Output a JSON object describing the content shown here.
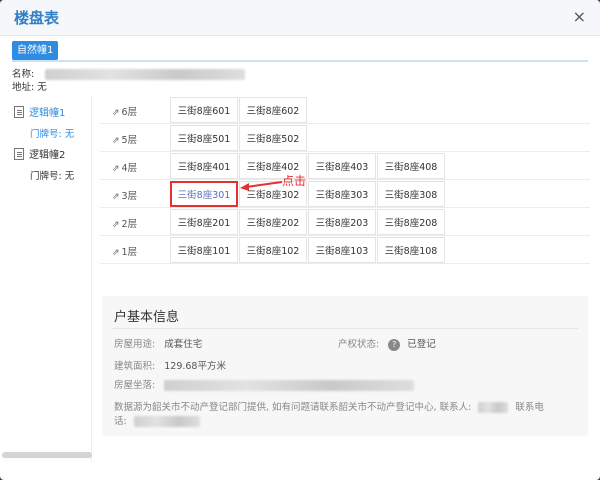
{
  "dialog": {
    "title": "楼盘表",
    "close_glyph": "×"
  },
  "tab": {
    "label": "自然幢1"
  },
  "meta": {
    "name_label": "名称:",
    "address_label": "地址:",
    "address_value": "无"
  },
  "sidebar": {
    "items": [
      {
        "label": "逻辑幢1",
        "door_label": "门牌号: 无",
        "active": true
      },
      {
        "label": "逻辑幢2",
        "door_label": "门牌号: 无",
        "active": false
      }
    ]
  },
  "floors": [
    {
      "label": "6层",
      "units": [
        "三街8座601",
        "三街8座602"
      ]
    },
    {
      "label": "5层",
      "units": [
        "三街8座501",
        "三街8座502"
      ]
    },
    {
      "label": "4层",
      "units": [
        "三街8座401",
        "三街8座402",
        "三街8座403",
        "三街8座408"
      ]
    },
    {
      "label": "3层",
      "units": [
        "三街8座301",
        "三街8座302",
        "三街8座303",
        "三街8座308"
      ]
    },
    {
      "label": "2层",
      "units": [
        "三街8座201",
        "三街8座202",
        "三街8座203",
        "三街8座208"
      ]
    },
    {
      "label": "1层",
      "units": [
        "三街8座101",
        "三街8座102",
        "三街8座103",
        "三街8座108"
      ]
    }
  ],
  "selected_unit": "三街8座301",
  "annotation": {
    "text": "点击"
  },
  "info": {
    "heading": "户基本信息",
    "usage_label": "房屋用途:",
    "usage_value": "成套住宅",
    "status_label": "产权状态:",
    "status_value": "已登记",
    "area_label": "建筑面积:",
    "area_value": "129.68平方米",
    "location_label": "房屋坐落:",
    "source_note": "数据源为韶关市不动产登记部门提供, 如有问题请联系韶关市不动产登记中心, 联系人:",
    "phone_label": "联系电",
    "phone_label2": "话:"
  },
  "colors": {
    "accent": "#2f8ce0",
    "highlight": "#e53030"
  }
}
